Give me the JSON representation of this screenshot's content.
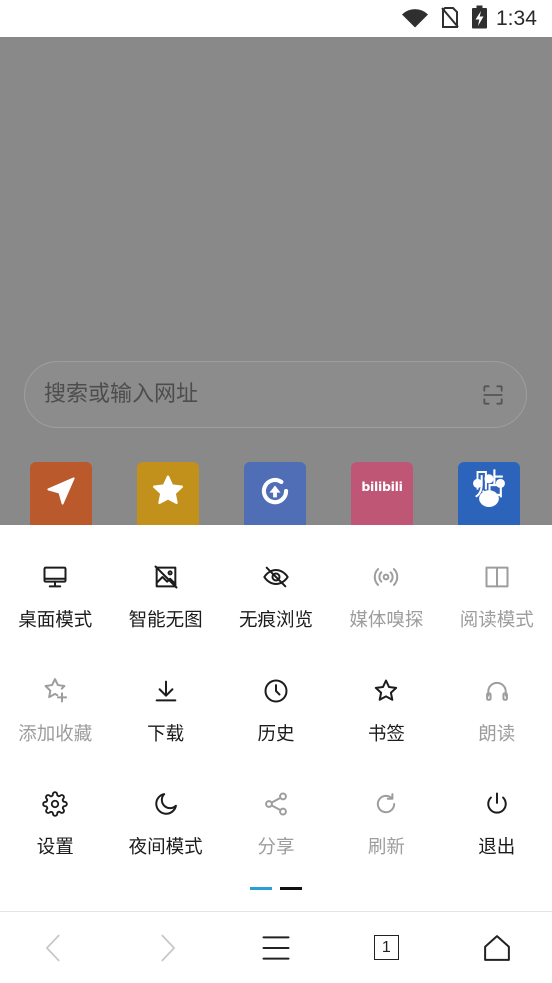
{
  "status_bar": {
    "time": "1:34",
    "icons": [
      "wifi-icon",
      "no-sim-icon",
      "battery-charging-icon"
    ]
  },
  "search": {
    "placeholder": "搜索或输入网址",
    "icon": "scan-icon"
  },
  "shortcuts": [
    {
      "icon": "navigation-icon",
      "color": "#b9592c"
    },
    {
      "icon": "star-icon",
      "color": "#c2911c"
    },
    {
      "icon": "app-logo-icon",
      "color": "#506eb5"
    },
    {
      "icon": "bilibili-logo",
      "color": "#c05676",
      "logo_text": "bilibili"
    },
    {
      "icon": "tieba-logo",
      "color": "#2c63bb",
      "logo_text": "贴"
    }
  ],
  "menu": {
    "items": [
      {
        "label": "桌面模式",
        "icon": "desktop-icon",
        "enabled": true
      },
      {
        "label": "智能无图",
        "icon": "no-image-icon",
        "enabled": true
      },
      {
        "label": "无痕浏览",
        "icon": "eye-off-icon",
        "enabled": true
      },
      {
        "label": "媒体嗅探",
        "icon": "radio-waves-icon",
        "enabled": false
      },
      {
        "label": "阅读模式",
        "icon": "reader-icon",
        "enabled": false
      },
      {
        "label": "添加收藏",
        "icon": "star-plus-icon",
        "enabled": false
      },
      {
        "label": "下载",
        "icon": "download-icon",
        "enabled": true
      },
      {
        "label": "历史",
        "icon": "clock-icon",
        "enabled": true
      },
      {
        "label": "书签",
        "icon": "star-icon",
        "enabled": true
      },
      {
        "label": "朗读",
        "icon": "headphones-icon",
        "enabled": false
      },
      {
        "label": "设置",
        "icon": "gear-icon",
        "enabled": true
      },
      {
        "label": "夜间模式",
        "icon": "moon-icon",
        "enabled": true
      },
      {
        "label": "分享",
        "icon": "share-icon",
        "enabled": false
      },
      {
        "label": "刷新",
        "icon": "refresh-icon",
        "enabled": false
      },
      {
        "label": "退出",
        "icon": "power-icon",
        "enabled": true
      }
    ],
    "page_indicator": {
      "pages": 2,
      "active_index": 0
    }
  },
  "bottom_nav": {
    "items": [
      {
        "icon": "back-icon",
        "enabled": false
      },
      {
        "icon": "forward-icon",
        "enabled": false
      },
      {
        "icon": "menu-icon",
        "enabled": true
      },
      {
        "icon": "tabs-icon",
        "enabled": true
      },
      {
        "icon": "home-icon",
        "enabled": true
      }
    ],
    "tab_count": "1"
  },
  "colors": {
    "scrim": "#898989",
    "text": "#1c1c1c",
    "disabled": "#9d9d9d",
    "accent": "#2a9ed8",
    "indicator_inactive": "#111111"
  }
}
